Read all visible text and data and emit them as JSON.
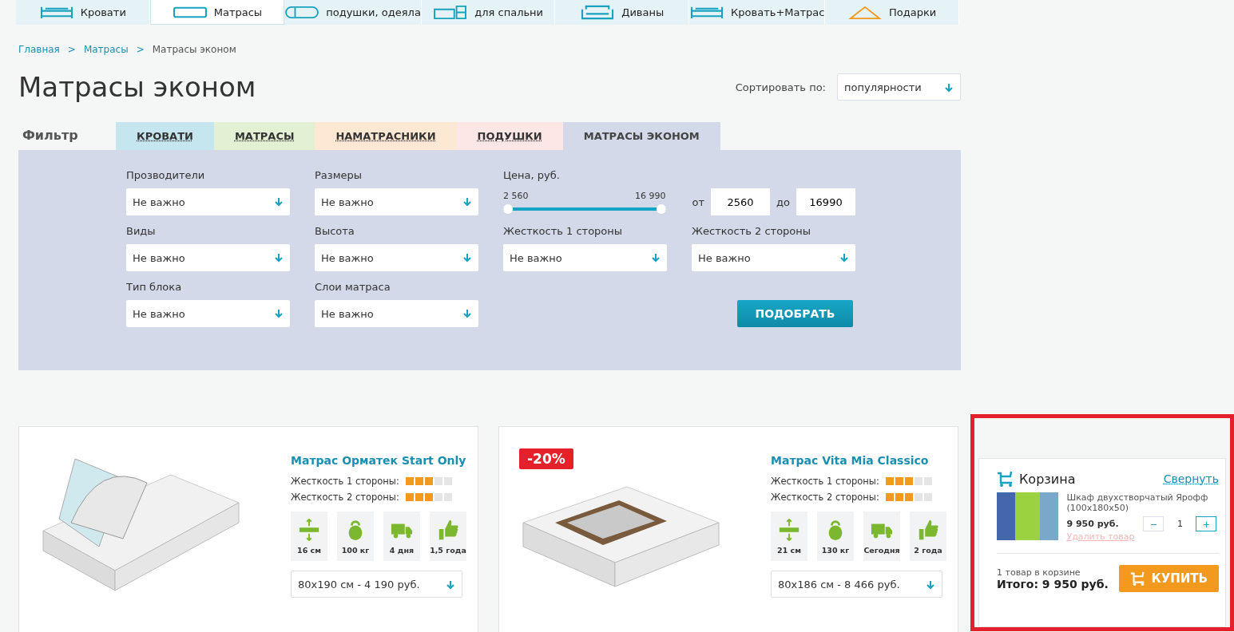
{
  "nav": [
    {
      "label": "Кровати",
      "kind": "bed",
      "selected": false
    },
    {
      "label": "Матрасы",
      "kind": "mattress",
      "selected": true
    },
    {
      "label": "подушки, одеяла",
      "kind": "pillow",
      "selected": false
    },
    {
      "label": "для спальни",
      "kind": "dresser",
      "selected": false
    },
    {
      "label": "Диваны",
      "kind": "sofa",
      "selected": false
    },
    {
      "label": "Кровать+Матрас",
      "kind": "bed",
      "selected": false
    },
    {
      "label": "Подарки",
      "kind": "gift",
      "selected": false
    }
  ],
  "breadcrumbs": [
    {
      "label": "Главная",
      "link": true
    },
    {
      "label": "Матрасы",
      "link": true
    },
    {
      "label": "Матрасы эконом",
      "link": false
    }
  ],
  "breadcrumb_separator": ">",
  "title": "Матрасы эконом",
  "sort": {
    "label": "Сортировать по:",
    "value": "популярности"
  },
  "filter": {
    "label": "Фильтр",
    "tabs": [
      {
        "label": "КРОВАТИ",
        "color": "#c5e6ef",
        "selected": false
      },
      {
        "label": "МАТРАСЫ",
        "color": "#e3f0d3",
        "selected": false
      },
      {
        "label": "НАМАТРАСНИКИ",
        "color": "#fde8d3",
        "selected": false
      },
      {
        "label": "ПОДУШКИ",
        "color": "#fde6e6",
        "selected": false
      },
      {
        "label": "МАТРАСЫ ЭКОНОМ",
        "color": "#d3d9e8",
        "selected": true
      }
    ],
    "selects": [
      {
        "label": "Прозводители",
        "value": "Не важно"
      },
      {
        "label": "Размеры",
        "value": "Не важно"
      },
      {
        "label": "Виды",
        "value": "Не важно"
      },
      {
        "label": "Высота",
        "value": "Не важно"
      },
      {
        "label": "Тип блока",
        "value": "Не важно"
      },
      {
        "label": "Слои матраса",
        "value": "Не важно"
      }
    ],
    "price": {
      "label": "Цена, руб.",
      "min_label": "2 560",
      "max_label": "16 990",
      "level": 1,
      "from_label": "от",
      "from": "2560",
      "to_label": "до",
      "to": "16990"
    },
    "hardness": [
      {
        "label": "Жесткость 1 стороны",
        "value": "Не важно"
      },
      {
        "label": "Жесткость 2 стороны",
        "value": "Не важно"
      }
    ],
    "submit": "ПОДОБРАТЬ"
  },
  "products": [
    {
      "name": "Матрас Орматек Start Only",
      "kind": "open",
      "hardness": [
        {
          "label": "Жесткость 1 стороны:",
          "stars": 3
        },
        {
          "label": "Жесткость 2 стороны:",
          "stars": 3
        }
      ],
      "features": [
        {
          "kind": "height",
          "label": "16 см"
        },
        {
          "kind": "weight",
          "label": "100 кг"
        },
        {
          "kind": "delivery",
          "label": "4 дня"
        },
        {
          "kind": "warranty",
          "label": "1,5 года"
        }
      ],
      "option": "80x190 см - 4 190 руб."
    },
    {
      "name": "Матрас Vita Mia Classico",
      "badge": "-20%",
      "kind": "cut",
      "hardness": [
        {
          "label": "Жесткость 1 стороны:",
          "stars": 3
        },
        {
          "label": "Жесткость 2 стороны:",
          "stars": 3
        }
      ],
      "features": [
        {
          "kind": "height",
          "label": "21 см"
        },
        {
          "kind": "weight",
          "label": "130 кг"
        },
        {
          "kind": "delivery",
          "label": "Сегодня"
        },
        {
          "kind": "warranty",
          "label": "2 года"
        }
      ],
      "option": "80x186 см - 8 466 руб."
    }
  ],
  "cart": {
    "title": "Корзина",
    "collapse": "Свернуть",
    "item": {
      "name": "Шкаф двухстворчатый Ярофф (100x180x50)",
      "price": "9 950 руб.",
      "qty": "1",
      "minus": "−",
      "plus": "+",
      "remove": "Удалить товар"
    },
    "count": "1 товар в корзине",
    "total": "Итого: 9 950 руб.",
    "buy": "КУПИТЬ"
  }
}
